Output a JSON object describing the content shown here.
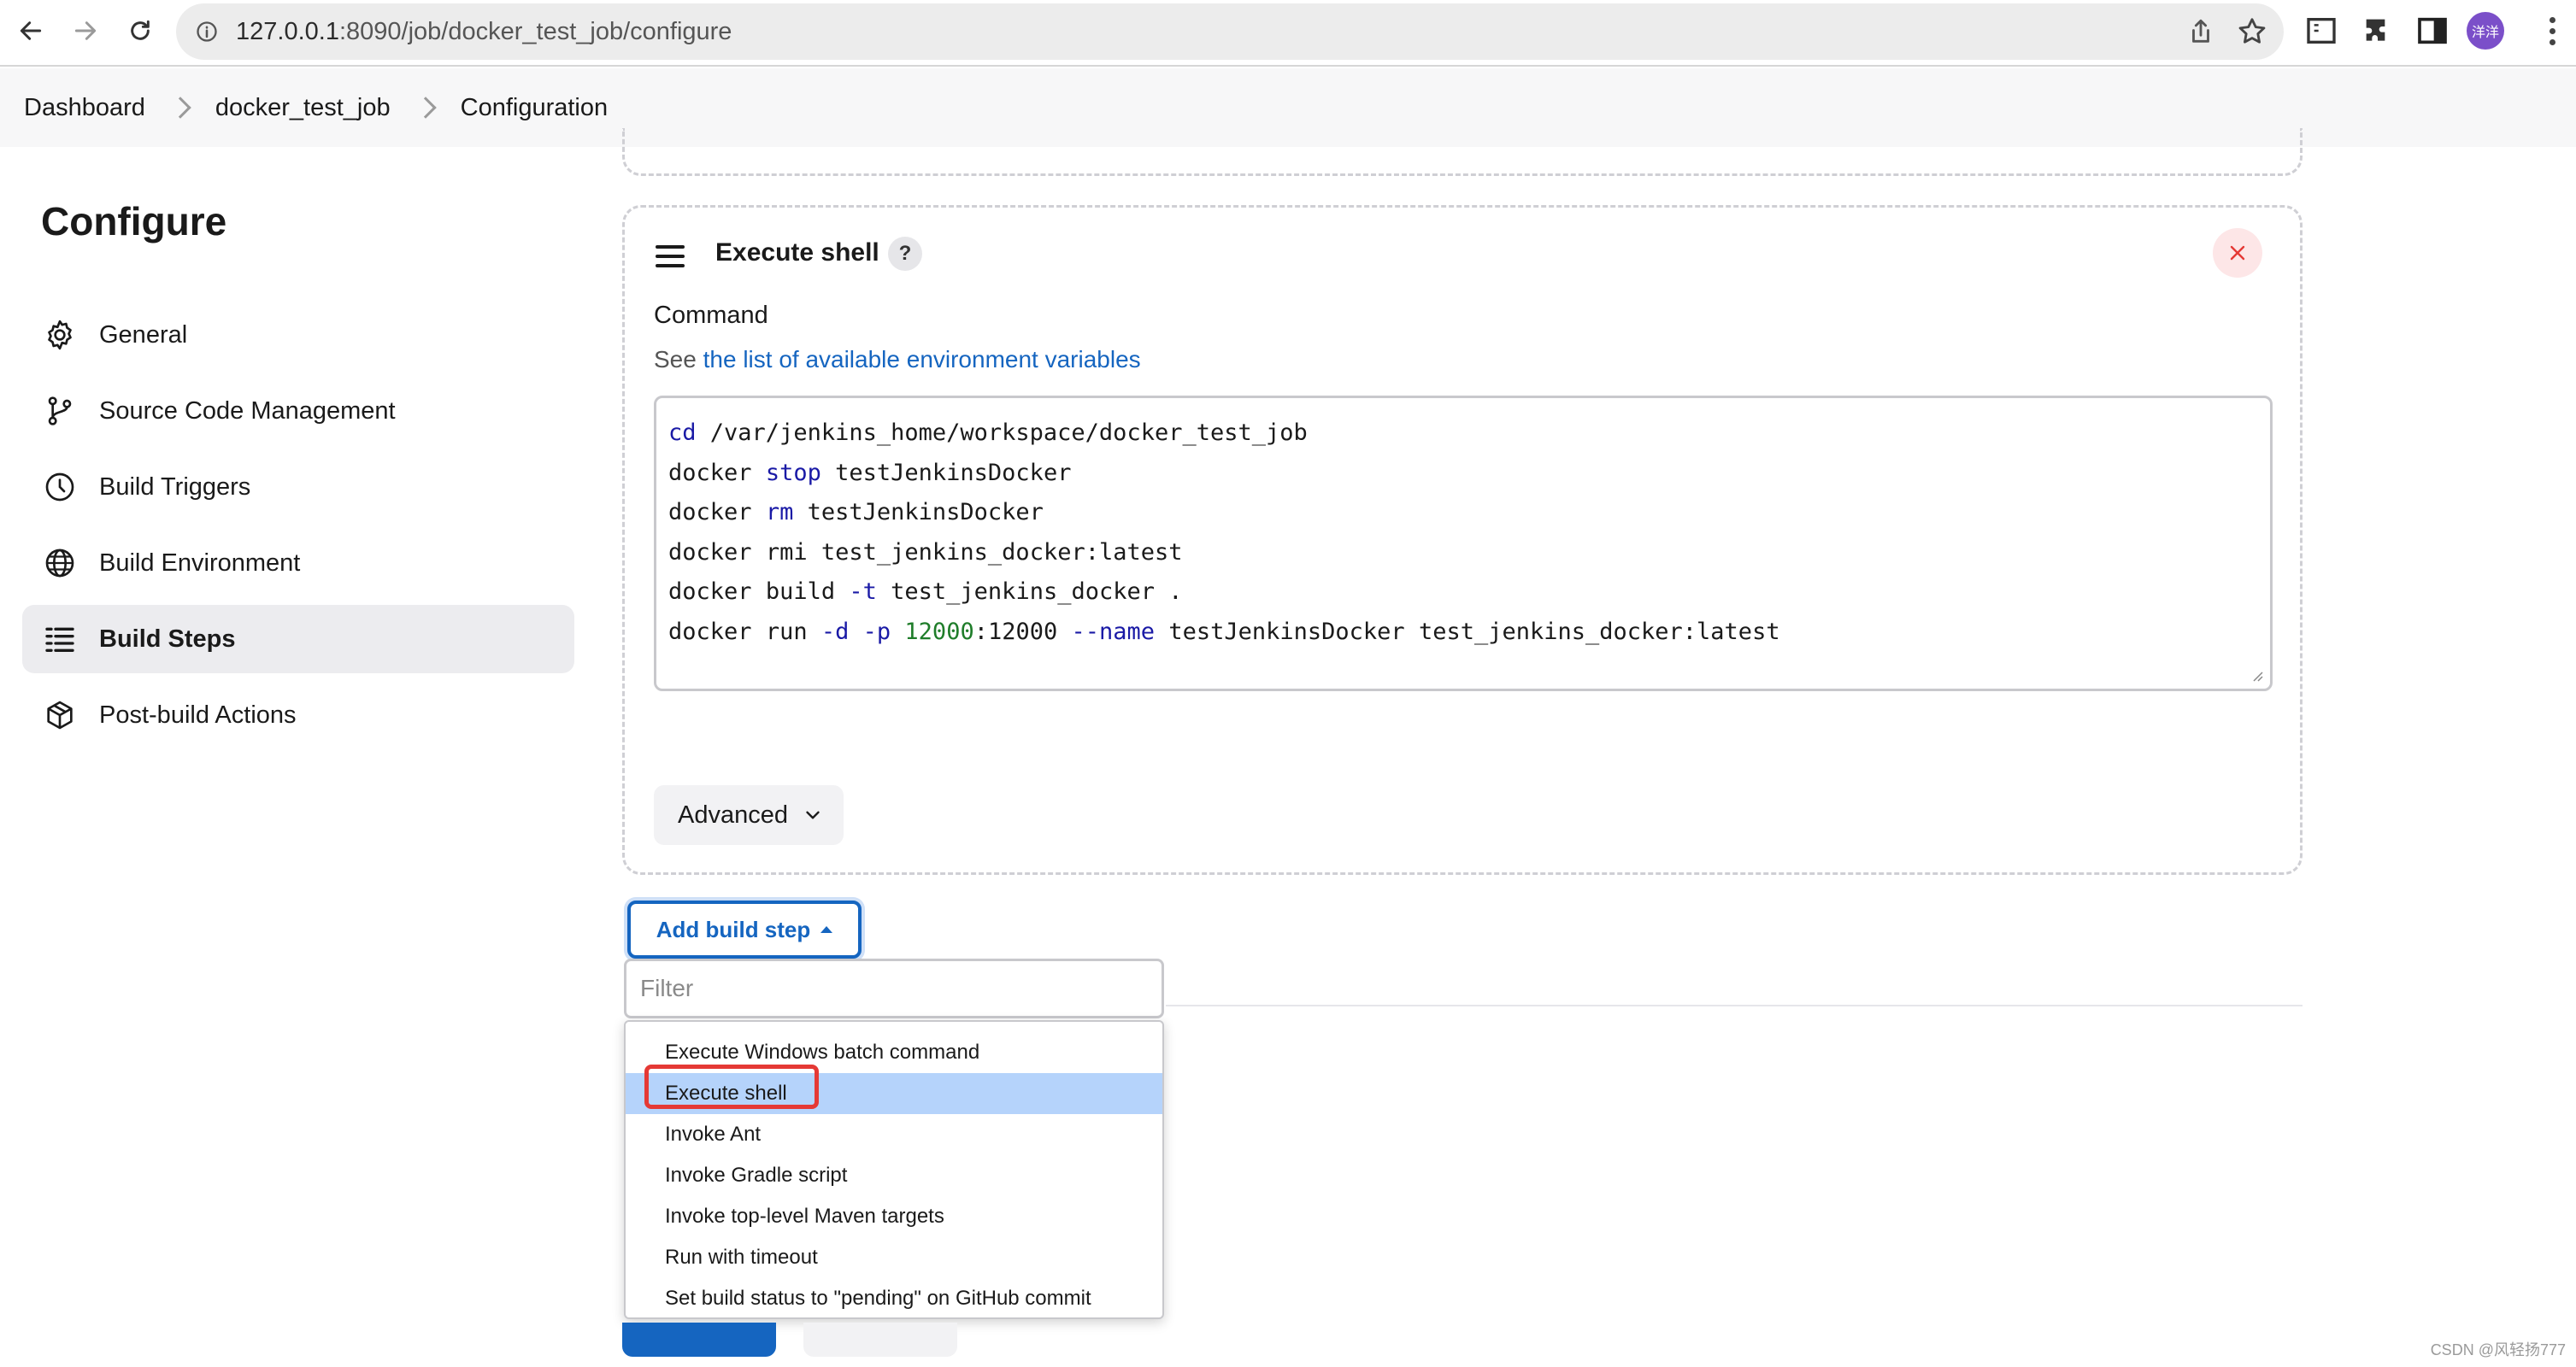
{
  "browser": {
    "url_host": "127.0.0.1",
    "url_path": ":8090/job/docker_test_job/configure",
    "profile_initials": "洋洋"
  },
  "breadcrumb": [
    "Dashboard",
    "docker_test_job",
    "Configuration"
  ],
  "sidebar": {
    "title": "Configure",
    "items": [
      {
        "label": "General",
        "icon": "gear-icon",
        "active": false
      },
      {
        "label": "Source Code Management",
        "icon": "branch-icon",
        "active": false
      },
      {
        "label": "Build Triggers",
        "icon": "clock-icon",
        "active": false
      },
      {
        "label": "Build Environment",
        "icon": "globe-icon",
        "active": false
      },
      {
        "label": "Build Steps",
        "icon": "list-icon",
        "active": true
      },
      {
        "label": "Post-build Actions",
        "icon": "package-icon",
        "active": false
      }
    ]
  },
  "build_step": {
    "title": "Execute shell",
    "help": "?",
    "command_label": "Command",
    "help_prefix": "See",
    "help_link": "the list of available environment variables",
    "command_lines": [
      "cd /var/jenkins_home/workspace/docker_test_job",
      "docker stop testJenkinsDocker",
      "docker rm testJenkinsDocker",
      "docker rmi test_jenkins_docker:latest",
      "docker build -t test_jenkins_docker .",
      "docker run -d -p 12000:12000 --name testJenkinsDocker test_jenkins_docker:latest"
    ],
    "advanced_label": "Advanced"
  },
  "add_step": {
    "button_label": "Add build step",
    "filter_placeholder": "Filter",
    "options": [
      {
        "label": "Execute Windows batch command",
        "selected": false
      },
      {
        "label": "Execute shell",
        "selected": true
      },
      {
        "label": "Invoke Ant",
        "selected": false
      },
      {
        "label": "Invoke Gradle script",
        "selected": false
      },
      {
        "label": "Invoke top-level Maven targets",
        "selected": false
      },
      {
        "label": "Run with timeout",
        "selected": false
      },
      {
        "label": "Set build status to \"pending\" on GitHub commit",
        "selected": false
      }
    ]
  },
  "watermark": "CSDN @风轻扬777",
  "colors": {
    "accent": "#1565c0",
    "selected_bg": "#b5d3fb",
    "highlight": "#e53935"
  }
}
